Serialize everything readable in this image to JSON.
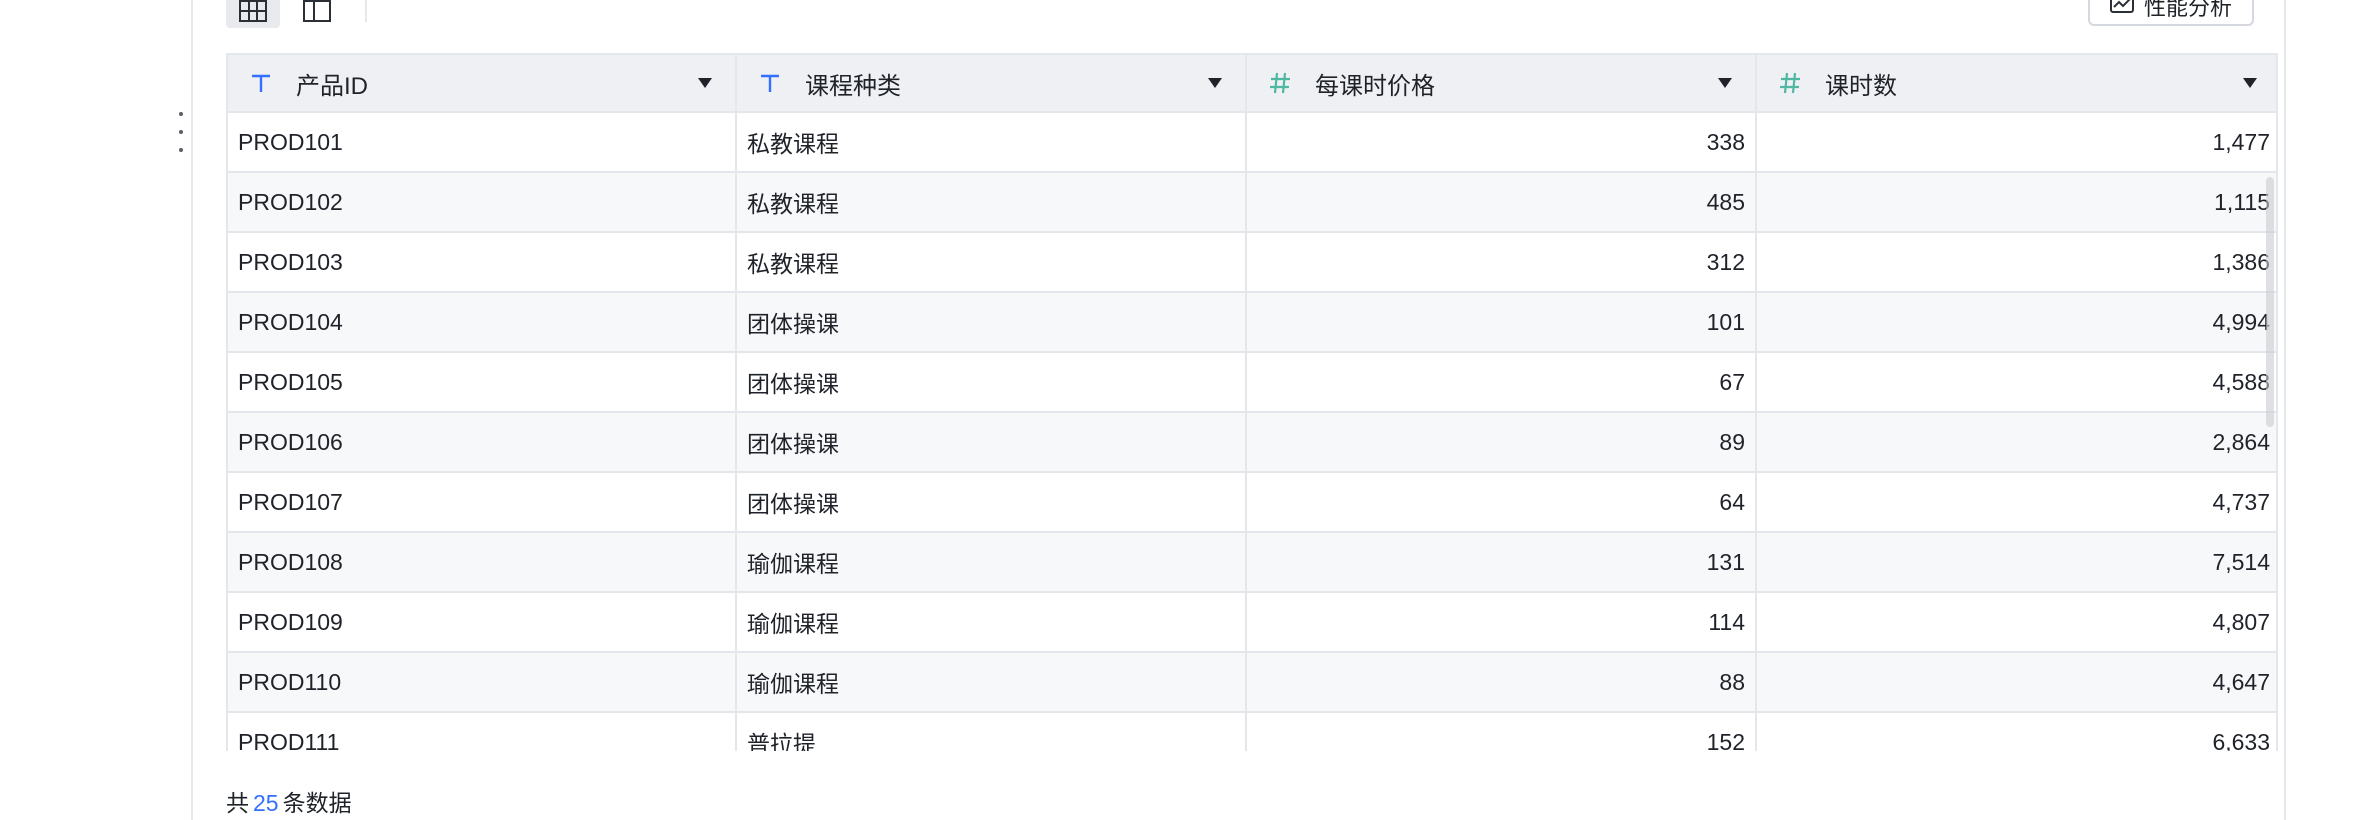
{
  "toolbar": {
    "perf_button_label": "性能分析"
  },
  "table": {
    "columns": [
      {
        "label": "产品ID",
        "type_icon": "text-type-icon"
      },
      {
        "label": "课程种类",
        "type_icon": "text-type-icon"
      },
      {
        "label": "每课时价格",
        "type_icon": "number-type-icon"
      },
      {
        "label": "课时数",
        "type_icon": "number-type-icon"
      }
    ],
    "rows": [
      [
        "PROD101",
        "私教课程",
        "338",
        "1,477"
      ],
      [
        "PROD102",
        "私教课程",
        "485",
        "1,115"
      ],
      [
        "PROD103",
        "私教课程",
        "312",
        "1,386"
      ],
      [
        "PROD104",
        "团体操课",
        "101",
        "4,994"
      ],
      [
        "PROD105",
        "团体操课",
        "67",
        "4,588"
      ],
      [
        "PROD106",
        "团体操课",
        "89",
        "2,864"
      ],
      [
        "PROD107",
        "团体操课",
        "64",
        "4,737"
      ],
      [
        "PROD108",
        "瑜伽课程",
        "131",
        "7,514"
      ],
      [
        "PROD109",
        "瑜伽课程",
        "114",
        "4,807"
      ],
      [
        "PROD110",
        "瑜伽课程",
        "88",
        "4,647"
      ],
      [
        "PROD111",
        "普拉提",
        "152",
        "6,633"
      ]
    ]
  },
  "footer": {
    "prefix": "共",
    "count": "25",
    "suffix": "条数据"
  },
  "colors": {
    "text_type_icon": "#3370ff",
    "number_type_icon": "#4fb7a2",
    "header_bg": "#eef0f4",
    "link": "#3370ff"
  }
}
